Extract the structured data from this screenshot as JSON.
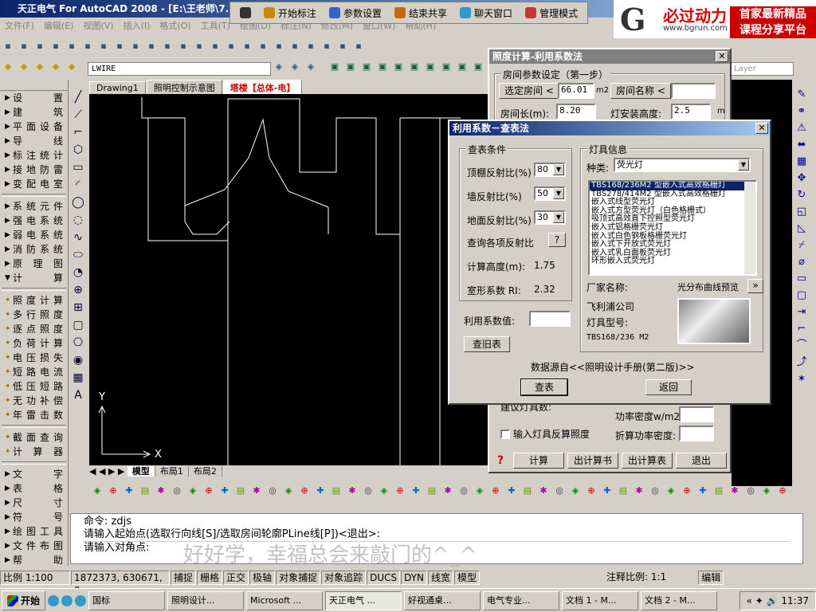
{
  "app_title": "天正电气 For AutoCAD 2008 - [E:\\王老师\\7.13]",
  "menu": [
    "文件(F)",
    "编辑(E)",
    "视图(V)",
    "插入(I)",
    "格式(O)",
    "工具(T)",
    "绘图(D)",
    "标注(N)",
    "修改(M)",
    "窗口(W)",
    "帮助(H)"
  ],
  "top_toolbar": {
    "items": [
      {
        "icon": "pen-icon",
        "label": ""
      },
      {
        "icon": "mark-icon",
        "label": "开始标注"
      },
      {
        "icon": "settings-icon",
        "label": "参数设置"
      },
      {
        "icon": "stop-share-icon",
        "label": "结束共享"
      },
      {
        "icon": "chat-icon",
        "label": "聊天窗口"
      },
      {
        "icon": "admin-icon",
        "label": "管理模式"
      }
    ]
  },
  "logo": {
    "line1": "必过动力",
    "line2": "www.bgrun.com",
    "right1": "首家最新精品",
    "right2": "课程分享平台"
  },
  "layer_name": "LWIRE",
  "layer_right": "Layer",
  "search_hint": "键入问题以获取",
  "left_panel": [
    {
      "label": "设　置",
      "tri": "▶"
    },
    {
      "label": "建　筑",
      "tri": "▶"
    },
    {
      "label": "平面设备",
      "tri": "▶"
    },
    {
      "label": "导　线",
      "tri": "▶"
    },
    {
      "label": "标注统计",
      "tri": "▶"
    },
    {
      "label": "接地防雷",
      "tri": "▶"
    },
    {
      "label": "变配电室",
      "tri": "▶"
    },
    {
      "label": "系统元件",
      "tri": "▶"
    },
    {
      "label": "强电系统",
      "tri": "▶"
    },
    {
      "label": "弱电系统",
      "tri": "▶"
    },
    {
      "label": "消防系统",
      "tri": "▶"
    },
    {
      "label": "原 理 图",
      "tri": "▶"
    },
    {
      "label": "计　算",
      "tri": "▼"
    },
    {
      "label": "照度计算",
      "tri": "✦"
    },
    {
      "label": "多行照度",
      "tri": "✦"
    },
    {
      "label": "逐点照度",
      "tri": "✦"
    },
    {
      "label": "负荷计算",
      "tri": "✦"
    },
    {
      "label": "电压损失",
      "tri": "✦"
    },
    {
      "label": "短路电流",
      "tri": "✦"
    },
    {
      "label": "低压短路",
      "tri": "✦"
    },
    {
      "label": "无功补偿",
      "tri": "✦"
    },
    {
      "label": "年雷击数",
      "tri": "✦"
    },
    {
      "label": "截面查询",
      "tri": "✦"
    },
    {
      "label": "计 算 器",
      "tri": "✦"
    },
    {
      "label": "文　字",
      "tri": "▶"
    },
    {
      "label": "表　格",
      "tri": "▶"
    },
    {
      "label": "尺　寸",
      "tri": "▶"
    },
    {
      "label": "符　号",
      "tri": "▶"
    },
    {
      "label": "绘图工具",
      "tri": "▶"
    },
    {
      "label": "文件布图",
      "tri": "▶"
    },
    {
      "label": "帮　助",
      "tri": "▶"
    }
  ],
  "drawing_tabs": [
    "Drawing1",
    "照明控制示意图",
    "塔楼【总体-电】"
  ],
  "layout_tabs": [
    "模型",
    "布局1",
    "布局2"
  ],
  "axis": {
    "x": "X",
    "y": "Y"
  },
  "dialog1": {
    "title": "照度计算-利用系数法",
    "group": "房间参数设定（第一步）",
    "select_room": "选定房间",
    "area_value": "66.01",
    "area_unit": "m2",
    "room_name_btn": "房间名称",
    "room_name_value": "",
    "room_length_label": "房间长(m):",
    "room_length_value": "8.20",
    "lamp_height_label": "灯安装高度:",
    "lamp_height_value": "2.5",
    "lamp_height_unit": "m",
    "suggest_label": "建议灯具数:",
    "power_density_label": "功率密度w/m2:",
    "reverse_label": "输入灯具反算照度",
    "conv_power_label": "折算功率密度:",
    "buttons": [
      "计算",
      "出计算书",
      "出计算表",
      "退出"
    ]
  },
  "dialog2": {
    "title": "利用系数－查表法",
    "query_group": "查表条件",
    "ceiling_label": "顶棚反射比(%)",
    "ceiling_value": "80",
    "wall_label": "墙反射比(%)",
    "wall_value": "50",
    "floor_label": "地面反射比(%)",
    "floor_value": "30",
    "query_all_label": "查询各项反射比",
    "query_all_btn": "?",
    "calc_height_label": "计算高度(m):",
    "calc_height_value": "1.75",
    "room_factor_label": "室形系数 RI:",
    "room_factor_value": "2.32",
    "util_label": "利用系数值:",
    "util_value": "",
    "lookup_btn": "查旧表",
    "lamp_group": "灯具信息",
    "type_label": "种类:",
    "type_value": "荧光灯",
    "lamps": [
      "TBS168/236M2 型嵌入式高效格栅灯",
      "TBS278/414M2 型嵌入式高效格栅灯",
      "嵌入式线型荧光灯",
      "嵌入式方型荧光灯（白色格栅式）",
      "吸顶式高效直下控照型荧光灯",
      "嵌入式铝格栅荧光灯",
      "嵌入式白色钢板格栅荧光灯",
      "嵌入式下开放式荧光灯",
      "嵌入式乳白面板荧光灯",
      "环形嵌入式荧光灯"
    ],
    "manufacturer_label": "厂家名称:",
    "curve_btn": "光分布曲线预览",
    "manufacturer_value": "飞利浦公司",
    "model_label": "灯具型号:",
    "model_value": "TBS168/236 M2",
    "source_text": "数据源自<<照明设计手册(第二版)>>",
    "query_btn": "查表",
    "back_btn": "返回"
  },
  "command_lines": [
    "命令: zdjs",
    "请输入起始点(选取行向线[S]/选取房间轮廓PLine线[P])<退出>:",
    "请输入对角点:"
  ],
  "watermark": "好好学，幸福总会来敲门的^_^",
  "status": {
    "scale": "比例 1:100",
    "coords": "1872373, 630671, 0",
    "toggles": [
      "捕捉",
      "栅格",
      "正交",
      "极轴",
      "对象捕捉",
      "对象追踪",
      "DUCS",
      "DYN",
      "线宽",
      "模型"
    ],
    "anno_scale": "注释比例: 1:1",
    "edit": "编辑"
  },
  "taskbar": {
    "start": "开始",
    "tasks": [
      "国标",
      "照明设计...",
      "Microsoft ...",
      "天正电气 ...",
      "好视通桌...",
      "电气专业...",
      "文档 1 - M...",
      "文档 2 - M..."
    ],
    "time": "11:37"
  }
}
